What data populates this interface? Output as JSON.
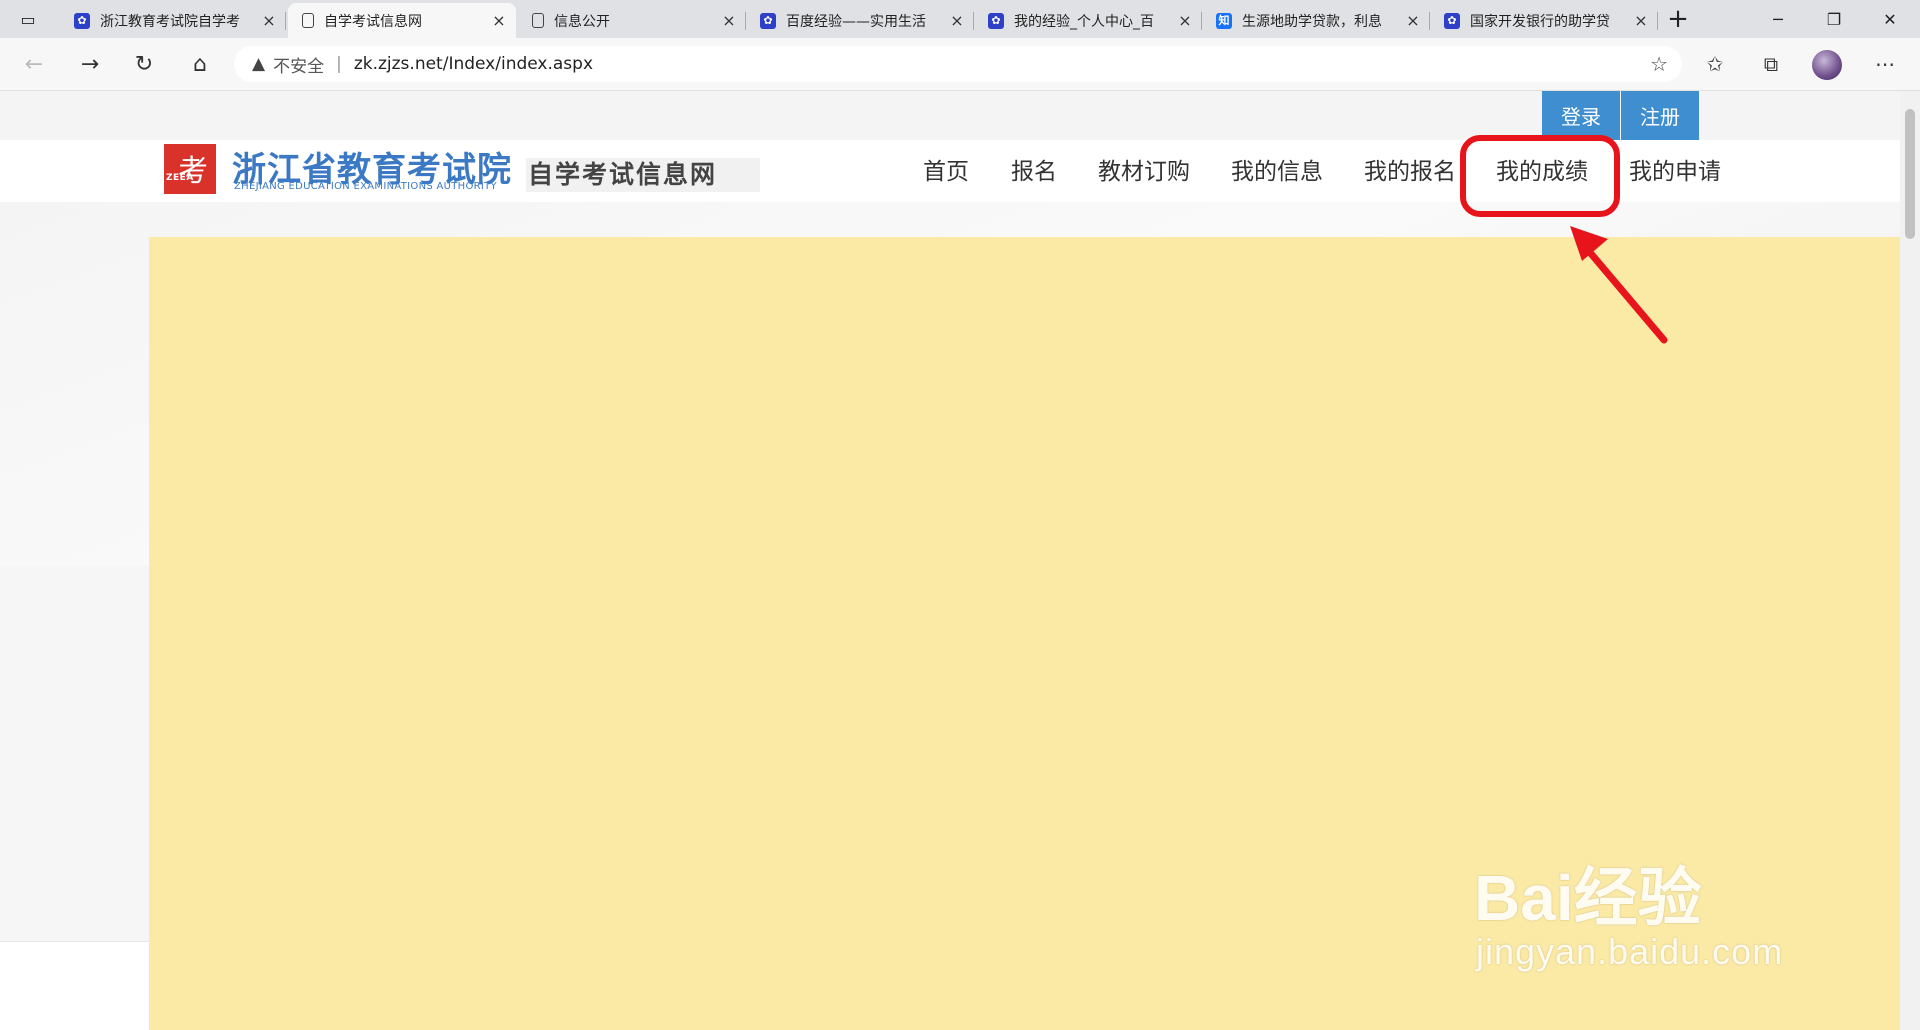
{
  "browser": {
    "tabs": [
      {
        "title": "浙江教育考试院自学考",
        "icon": "baidu-paw-icon",
        "active": false
      },
      {
        "title": "自学考试信息网",
        "icon": "page-icon",
        "active": true
      },
      {
        "title": "信息公开",
        "icon": "page-icon",
        "active": false
      },
      {
        "title": "百度经验——实用生活",
        "icon": "baidu-paw-icon",
        "active": false
      },
      {
        "title": "我的经验_个人中心_百",
        "icon": "baidu-paw-icon",
        "active": false
      },
      {
        "title": "生源地助学贷款，利息",
        "icon": "zhihu-icon",
        "active": false
      },
      {
        "title": "国家开发银行的助学贷",
        "icon": "baidu-paw-icon",
        "active": false
      }
    ],
    "zhihu_icon_text": "知",
    "new_tab_symbol": "+",
    "address": {
      "security_label": "不安全",
      "url": "zk.zjzs.net/Index/index.aspx"
    }
  },
  "site": {
    "auth": {
      "login": "登录",
      "register": "注册"
    },
    "logo": {
      "mark_char": "考",
      "mark_abbr": "ZEEA",
      "name_cn": "浙江省教育考试院",
      "name_en": "ZHEJIANG EDUCATION EXAMINATIONS AUTHORITY",
      "subtitle": "自学考试信息网"
    },
    "nav": [
      "首页",
      "报名",
      "教材订购",
      "我的信息",
      "我的报名",
      "我的成绩",
      "我的申请"
    ],
    "highlighted_nav": "我的成绩"
  },
  "watermark": {
    "main": "Bai经验",
    "sub": "jingyan.baidu.com"
  },
  "colors": {
    "content_bg": "#fbe9a6",
    "auth_button": "#3f8ecf",
    "highlight": "#e8141b",
    "logo_blue": "#3b79c4",
    "logo_red": "#d9322b"
  }
}
